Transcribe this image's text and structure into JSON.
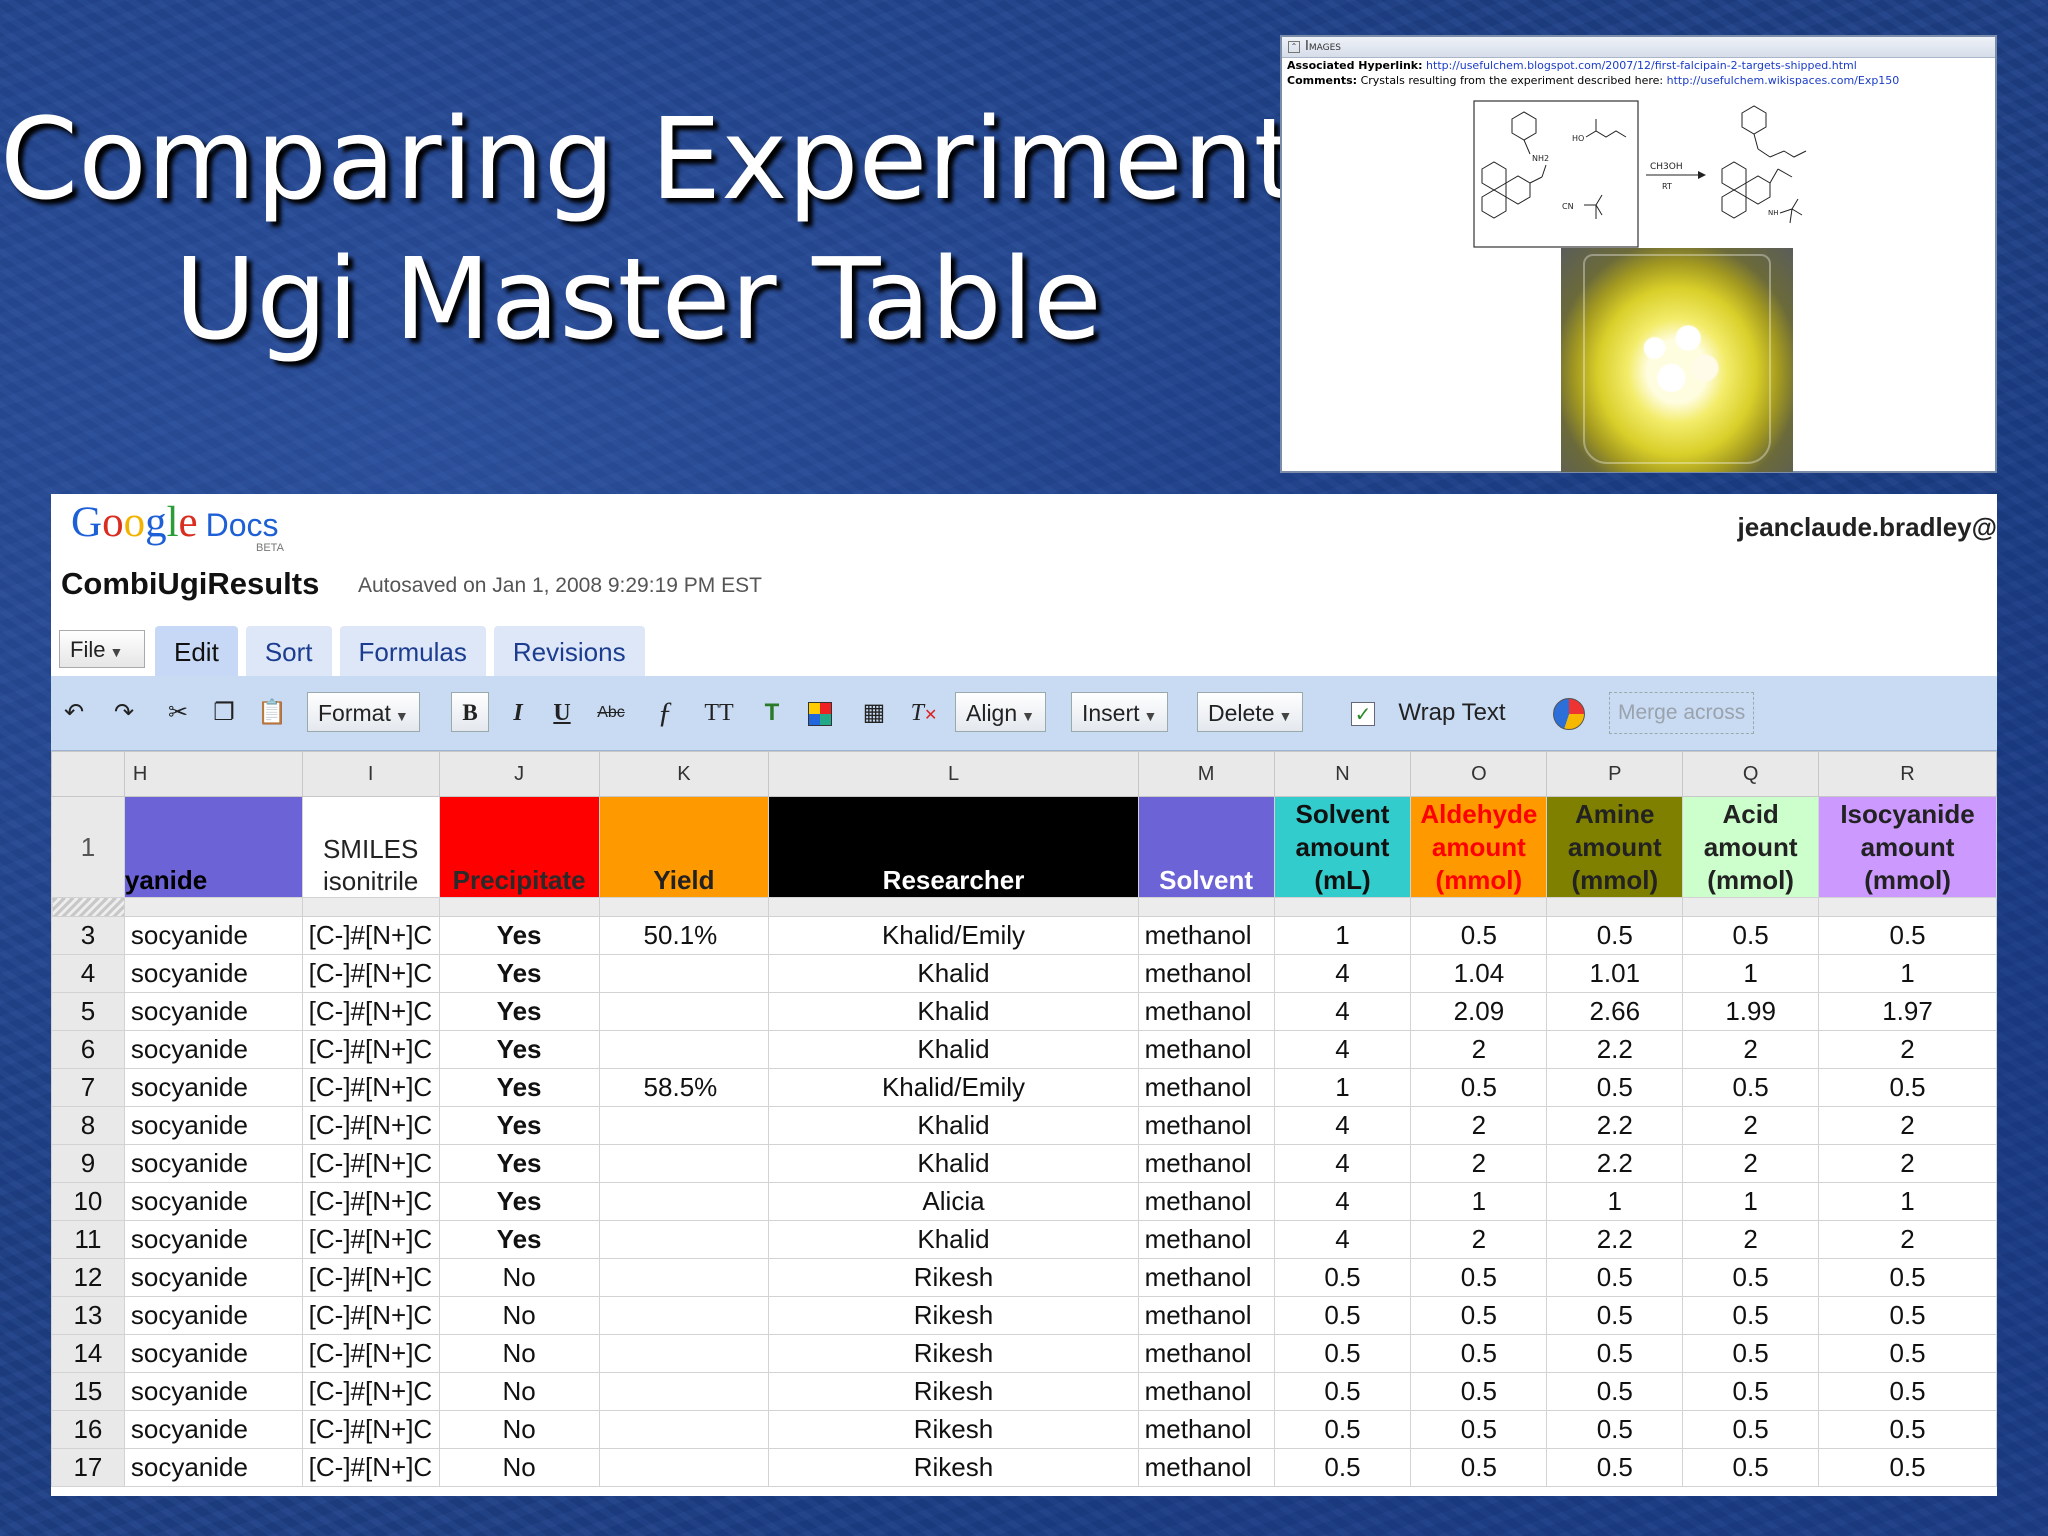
{
  "slide": {
    "title_line1": "Comparing Experiments",
    "title_line2": "Ugi Master Table"
  },
  "images_panel": {
    "header": "Images",
    "hyperlink_label": "Associated Hyperlink:",
    "hyperlink_url": "http://usefulchem.blogspot.com/2007/12/first-falcipain-2-targets-shipped.html",
    "comments_label": "Comments:",
    "comments_text": "Crystals resulting from the experiment described here:",
    "comments_url": "http://usefulchem.wikispaces.com/Exp150",
    "scheme_labels": {
      "amine": "NH2",
      "acid": "HO",
      "isonitrile": "CN",
      "solvent": "CH3OH",
      "temp": "RT",
      "nh": "NH"
    }
  },
  "docs": {
    "logo_google": [
      "G",
      "o",
      "o",
      "g",
      "l",
      "e"
    ],
    "logo_docs": "Docs",
    "logo_beta": "BETA",
    "user": "jeanclaude.bradley@",
    "doc_title": "CombiUgiResults",
    "autosave": "Autosaved on Jan 1, 2008 9:29:19 PM EST",
    "file_label": "File",
    "tabs": [
      "Edit",
      "Sort",
      "Formulas",
      "Revisions"
    ],
    "toolbar": {
      "format": "Format",
      "bold": "B",
      "italic": "I",
      "underline": "U",
      "strike": "Abc",
      "align": "Align",
      "insert": "Insert",
      "delete": "Delete",
      "wrap_text": "Wrap Text",
      "merge_across": "Merge across"
    },
    "columns": [
      "H",
      "I",
      "J",
      "K",
      "L",
      "M",
      "N",
      "O",
      "P",
      "Q",
      "R"
    ],
    "header_row_num": "1",
    "headers": [
      {
        "text": "yanide",
        "bg": "#6b63d6",
        "color": "#000000"
      },
      {
        "text": "SMILES isonitrile",
        "bg": "#ffffff",
        "color": "#222222"
      },
      {
        "text": "Precipitate",
        "bg": "#ff0000",
        "color": "#2a2a2a"
      },
      {
        "text": "Yield",
        "bg": "#ff9900",
        "color": "#222222"
      },
      {
        "text": "Researcher",
        "bg": "#000000",
        "color": "#ffffff"
      },
      {
        "text": "Solvent",
        "bg": "#6b63d6",
        "color": "#ffffff"
      },
      {
        "text": "Solvent amount (mL)",
        "bg": "#33cccc",
        "color": "#111111"
      },
      {
        "text": "Aldehyde amount (mmol)",
        "bg": "#ff9900",
        "color": "#ff0000"
      },
      {
        "text": "Amine amount (mmol)",
        "bg": "#808000",
        "color": "#222222"
      },
      {
        "text": "Acid amount (mmol)",
        "bg": "#ccffcc",
        "color": "#222222"
      },
      {
        "text": "Isocyanide amount (mmol)",
        "bg": "#cc99ff",
        "color": "#222222"
      }
    ],
    "rows": [
      {
        "num": "3",
        "h": "socyanide",
        "i": "[C-]#[N+]C",
        "j": "Yes",
        "k": "50.1%",
        "l": "Khalid/Emily",
        "m": "methanol",
        "n": "1",
        "o": "0.5",
        "p": "0.5",
        "q": "0.5",
        "r": "0.5"
      },
      {
        "num": "4",
        "h": "socyanide",
        "i": "[C-]#[N+]C",
        "j": "Yes",
        "k": "",
        "l": "Khalid",
        "m": "methanol",
        "n": "4",
        "o": "1.04",
        "p": "1.01",
        "q": "1",
        "r": "1"
      },
      {
        "num": "5",
        "h": "socyanide",
        "i": "[C-]#[N+]C",
        "j": "Yes",
        "k": "",
        "l": "Khalid",
        "m": "methanol",
        "n": "4",
        "o": "2.09",
        "p": "2.66",
        "q": "1.99",
        "r": "1.97"
      },
      {
        "num": "6",
        "h": "socyanide",
        "i": "[C-]#[N+]C",
        "j": "Yes",
        "k": "",
        "l": "Khalid",
        "m": "methanol",
        "n": "4",
        "o": "2",
        "p": "2.2",
        "q": "2",
        "r": "2"
      },
      {
        "num": "7",
        "h": "socyanide",
        "i": "[C-]#[N+]C",
        "j": "Yes",
        "k": "58.5%",
        "l": "Khalid/Emily",
        "m": "methanol",
        "n": "1",
        "o": "0.5",
        "p": "0.5",
        "q": "0.5",
        "r": "0.5"
      },
      {
        "num": "8",
        "h": "socyanide",
        "i": "[C-]#[N+]C",
        "j": "Yes",
        "k": "",
        "l": "Khalid",
        "m": "methanol",
        "n": "4",
        "o": "2",
        "p": "2.2",
        "q": "2",
        "r": "2"
      },
      {
        "num": "9",
        "h": "socyanide",
        "i": "[C-]#[N+]C",
        "j": "Yes",
        "k": "",
        "l": "Khalid",
        "m": "methanol",
        "n": "4",
        "o": "2",
        "p": "2.2",
        "q": "2",
        "r": "2"
      },
      {
        "num": "10",
        "h": "socyanide",
        "i": "[C-]#[N+]C",
        "j": "Yes",
        "k": "",
        "l": "Alicia",
        "m": "methanol",
        "n": "4",
        "o": "1",
        "p": "1",
        "q": "1",
        "r": "1"
      },
      {
        "num": "11",
        "h": "socyanide",
        "i": "[C-]#[N+]C",
        "j": "Yes",
        "k": "",
        "l": "Khalid",
        "m": "methanol",
        "n": "4",
        "o": "2",
        "p": "2.2",
        "q": "2",
        "r": "2"
      },
      {
        "num": "12",
        "h": "socyanide",
        "i": "[C-]#[N+]C",
        "j": "No",
        "k": "",
        "l": "Rikesh",
        "m": "methanol",
        "n": "0.5",
        "o": "0.5",
        "p": "0.5",
        "q": "0.5",
        "r": "0.5"
      },
      {
        "num": "13",
        "h": "socyanide",
        "i": "[C-]#[N+]C",
        "j": "No",
        "k": "",
        "l": "Rikesh",
        "m": "methanol",
        "n": "0.5",
        "o": "0.5",
        "p": "0.5",
        "q": "0.5",
        "r": "0.5"
      },
      {
        "num": "14",
        "h": "socyanide",
        "i": "[C-]#[N+]C",
        "j": "No",
        "k": "",
        "l": "Rikesh",
        "m": "methanol",
        "n": "0.5",
        "o": "0.5",
        "p": "0.5",
        "q": "0.5",
        "r": "0.5"
      },
      {
        "num": "15",
        "h": "socyanide",
        "i": "[C-]#[N+]C",
        "j": "No",
        "k": "",
        "l": "Rikesh",
        "m": "methanol",
        "n": "0.5",
        "o": "0.5",
        "p": "0.5",
        "q": "0.5",
        "r": "0.5"
      },
      {
        "num": "16",
        "h": "socyanide",
        "i": "[C-]#[N+]C",
        "j": "No",
        "k": "",
        "l": "Rikesh",
        "m": "methanol",
        "n": "0.5",
        "o": "0.5",
        "p": "0.5",
        "q": "0.5",
        "r": "0.5"
      },
      {
        "num": "17",
        "h": "socyanide",
        "i": "[C-]#[N+]C",
        "j": "No",
        "k": "",
        "l": "Rikesh",
        "m": "methanol",
        "n": "0.5",
        "o": "0.5",
        "p": "0.5",
        "q": "0.5",
        "r": "0.5"
      }
    ]
  }
}
